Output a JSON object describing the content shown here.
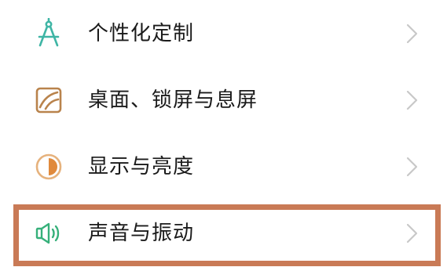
{
  "settings": {
    "items": [
      {
        "label": "个性化定制",
        "icon": "compass-drafting-icon",
        "icon_color": "#3fb5a5"
      },
      {
        "label": "桌面、锁屏与息屏",
        "icon": "wallpaper-icon",
        "icon_color": "#b9834c"
      },
      {
        "label": "显示与亮度",
        "icon": "half-circle-brightness-icon",
        "icon_color": "#e08a3c"
      },
      {
        "label": "声音与振动",
        "icon": "speaker-volume-icon",
        "icon_color": "#36b07a"
      }
    ],
    "highlight_color": "#c97a56",
    "chevron_color": "#c8c8c8"
  }
}
